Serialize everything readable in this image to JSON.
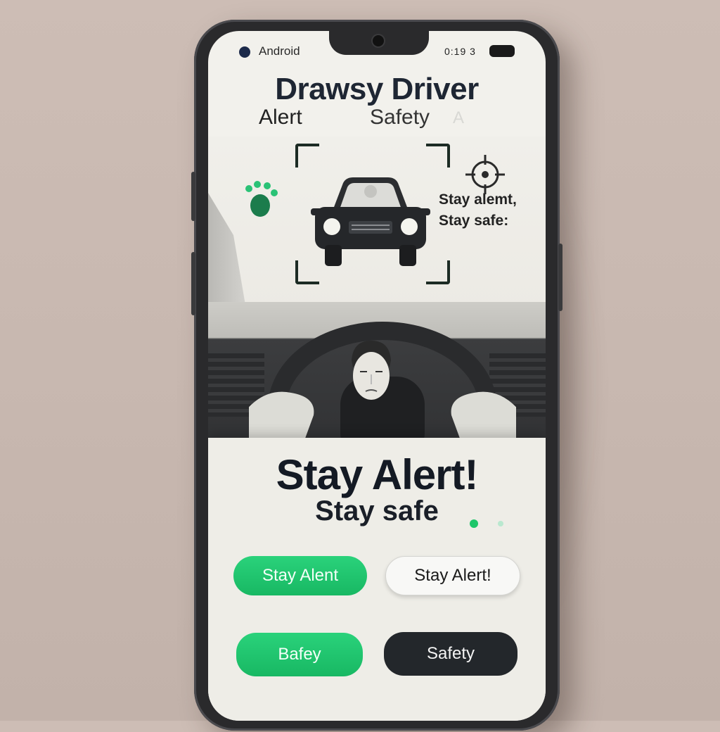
{
  "status_bar": {
    "label": "Android",
    "time": "0:19 3"
  },
  "header": {
    "title": "Drawsy Driver",
    "subtitle_left": "Alert",
    "subtitle_right": "Safety",
    "subtitle_faint": "A"
  },
  "scene": {
    "side_note_line1": "Stay alemt,",
    "side_note_line2": "Stay safe:"
  },
  "banner": {
    "headline": "Stay Alert!",
    "subline": "Stay safe"
  },
  "buttons": {
    "stay_alert_green": "Stay Alent",
    "stay_alert_white": "Stay Alert!",
    "safety_green": "Bafey",
    "safety_dark": "Safety"
  },
  "icons": {
    "status": "status-dot-icon",
    "battery": "battery-icon",
    "camera": "camera-icon",
    "car": "car-icon",
    "footprints": "footprints-icon",
    "target": "target-icon",
    "driver": "drowsy-face-icon",
    "wheel": "steering-wheel-icon"
  },
  "colors": {
    "accent_green": "#1ec66a",
    "dark": "#23272b",
    "title": "#1e2633"
  }
}
